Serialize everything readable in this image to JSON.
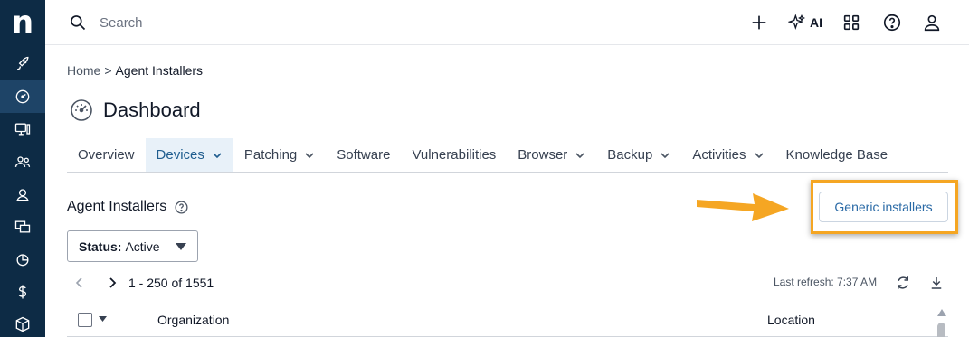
{
  "app": {
    "logo_text": "n"
  },
  "sidebar": {
    "items": [
      {
        "name": "rocket-icon",
        "active": false
      },
      {
        "name": "dashboard-icon",
        "active": true
      },
      {
        "name": "devices-icon",
        "active": false
      },
      {
        "name": "users-icon",
        "active": false
      },
      {
        "name": "technician-icon",
        "active": false
      },
      {
        "name": "remote-icon",
        "active": false
      },
      {
        "name": "reports-icon",
        "active": false
      },
      {
        "name": "billing-icon",
        "active": false
      },
      {
        "name": "package-icon",
        "active": false
      }
    ]
  },
  "topbar": {
    "search_placeholder": "Search",
    "ai_label": "AI",
    "icons": [
      "plus-icon",
      "sparkle-icon",
      "apps-grid-icon",
      "help-icon",
      "user-icon"
    ]
  },
  "breadcrumb": {
    "home": "Home",
    "separator": ">",
    "current": "Agent Installers"
  },
  "page": {
    "title": "Dashboard"
  },
  "tabs": [
    {
      "label": "Overview",
      "dropdown": false,
      "active": false
    },
    {
      "label": "Devices",
      "dropdown": true,
      "active": true
    },
    {
      "label": "Patching",
      "dropdown": true,
      "active": false
    },
    {
      "label": "Software",
      "dropdown": false,
      "active": false
    },
    {
      "label": "Vulnerabilities",
      "dropdown": false,
      "active": false
    },
    {
      "label": "Browser",
      "dropdown": true,
      "active": false
    },
    {
      "label": "Backup",
      "dropdown": true,
      "active": false
    },
    {
      "label": "Activities",
      "dropdown": true,
      "active": false
    },
    {
      "label": "Knowledge Base",
      "dropdown": false,
      "active": false
    }
  ],
  "section": {
    "title": "Agent Installers"
  },
  "actions": {
    "generic_installers": "Generic installers"
  },
  "filter": {
    "status_label": "Status:",
    "status_value": "Active"
  },
  "pager": {
    "range": "1 - 250 of 1551"
  },
  "refresh": {
    "text": "Last refresh: 7:37 AM"
  },
  "table": {
    "columns": [
      "Organization",
      "Location"
    ]
  },
  "colors": {
    "rail": "#0d2b45",
    "accent": "#2a6aa6",
    "active_tab_bg": "#e8f1f9",
    "highlight": "#f5a623"
  }
}
